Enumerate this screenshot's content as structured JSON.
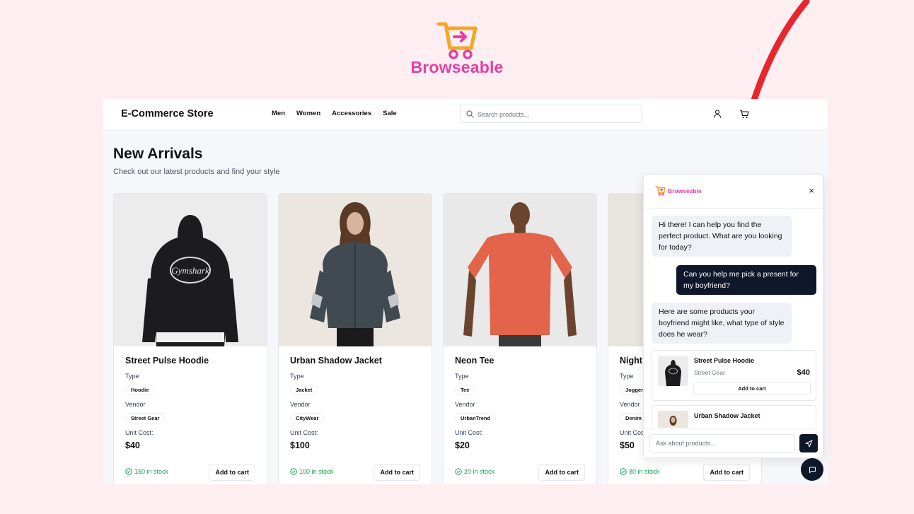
{
  "brand": {
    "name": "Browseable",
    "accent": "#e63fa5",
    "cart_color": "#f5a623"
  },
  "store": {
    "title": "E-Commerce Store",
    "nav": [
      "Men",
      "Women",
      "Accessories",
      "Sale"
    ],
    "search": {
      "placeholder": "Search products..."
    },
    "icons": [
      "user-icon",
      "cart-icon"
    ]
  },
  "page": {
    "heading": "New Arrivals",
    "subheading": "Check out our latest products and find your style"
  },
  "labels": {
    "type": "Type",
    "vendor": "Vendor",
    "unit_cost": "Unit Cost:",
    "add_to_cart": "Add to cart"
  },
  "products": [
    {
      "name": "Street Pulse Hoodie",
      "type": "Hoodie",
      "vendor": "Street Gear",
      "price": "$40",
      "stock": "150 in stock",
      "image": "black-hoodie"
    },
    {
      "name": "Urban Shadow Jacket",
      "type": "Jacket",
      "vendor": "CityWear",
      "price": "$100",
      "stock": "100 in stock",
      "image": "grey-jacket"
    },
    {
      "name": "Neon Tee",
      "type": "Tee",
      "vendor": "UrbanTrend",
      "price": "$20",
      "stock": "20 in stock",
      "image": "orange-tee"
    },
    {
      "name": "Night",
      "type": "Jogger",
      "vendor": "Denim",
      "price": "$50",
      "stock": "80 in stock",
      "image": "joggers"
    }
  ],
  "chat": {
    "brand": "Browseable",
    "messages": [
      {
        "from": "bot",
        "text": "Hi there! I can help you find the perfect product. What are you looking for today?"
      },
      {
        "from": "user",
        "text": "Can you help me pick a present for my boyfriend?"
      },
      {
        "from": "bot",
        "text": "Here are some products your boyfriend might like, what type of style does he wear?"
      }
    ],
    "suggestions": [
      {
        "name": "Street Pulse Hoodie",
        "vendor": "Street Gear",
        "price": "$40",
        "button": "Add to cart"
      },
      {
        "name": "Urban Shadow Jacket"
      }
    ],
    "input_placeholder": "Ask about products..."
  },
  "colors": {
    "background": "#fdeef2",
    "dark": "#0f172a",
    "stock_green": "#16a34a",
    "arrow_red": "#e8262e"
  }
}
